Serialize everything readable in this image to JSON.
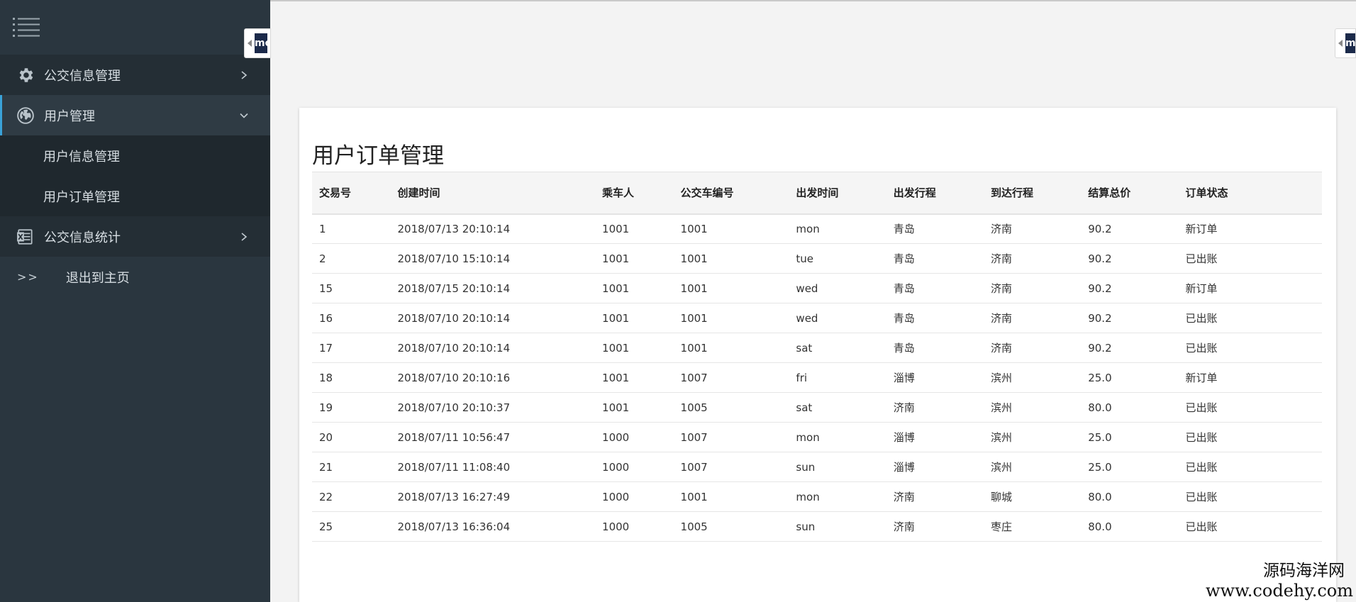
{
  "sidebar": {
    "menu": [
      {
        "label": "公交信息管理",
        "icon": "gear-icon",
        "expanded": false
      },
      {
        "label": "用户管理",
        "icon": "globe-icon",
        "expanded": true,
        "children": [
          {
            "label": "用户信息管理"
          },
          {
            "label": "用户订单管理"
          }
        ]
      },
      {
        "label": "公交信息统计",
        "icon": "excel-icon",
        "expanded": false
      }
    ],
    "exit": {
      "arrows": ">>",
      "label": "退出到主页"
    }
  },
  "card": {
    "title": "用户订单管理",
    "columns": [
      "交易号",
      "创建时间",
      "乘车人",
      "公交车编号",
      "出发时间",
      "出发行程",
      "到达行程",
      "结算总价",
      "订单状态"
    ],
    "rows": [
      [
        "1",
        "2018/07/13 20:10:14",
        "1001",
        "1001",
        "mon",
        "青岛",
        "济南",
        "90.2",
        "新订单"
      ],
      [
        "2",
        "2018/07/10 15:10:14",
        "1001",
        "1001",
        "tue",
        "青岛",
        "济南",
        "90.2",
        "已出账"
      ],
      [
        "15",
        "2018/07/15 20:10:14",
        "1001",
        "1001",
        "wed",
        "青岛",
        "济南",
        "90.2",
        "新订单"
      ],
      [
        "16",
        "2018/07/10 20:10:14",
        "1001",
        "1001",
        "wed",
        "青岛",
        "济南",
        "90.2",
        "已出账"
      ],
      [
        "17",
        "2018/07/10 20:10:14",
        "1001",
        "1001",
        "sat",
        "青岛",
        "济南",
        "90.2",
        "已出账"
      ],
      [
        "18",
        "2018/07/10 20:10:16",
        "1001",
        "1007",
        "fri",
        "淄博",
        "滨州",
        "25.0",
        "新订单"
      ],
      [
        "19",
        "2018/07/10 20:10:37",
        "1001",
        "1005",
        "sat",
        "济南",
        "滨州",
        "80.0",
        "已出账"
      ],
      [
        "20",
        "2018/07/11 10:56:47",
        "1000",
        "1007",
        "mon",
        "淄博",
        "滨州",
        "25.0",
        "已出账"
      ],
      [
        "21",
        "2018/07/11 11:08:40",
        "1000",
        "1007",
        "sun",
        "淄博",
        "滨州",
        "25.0",
        "已出账"
      ],
      [
        "22",
        "2018/07/13 16:27:49",
        "1000",
        "1001",
        "mon",
        "济南",
        "聊城",
        "80.0",
        "已出账"
      ],
      [
        "25",
        "2018/07/13 16:36:04",
        "1000",
        "1005",
        "sun",
        "济南",
        "枣庄",
        "80.0",
        "已出账"
      ]
    ]
  },
  "tabs": {
    "letter": "mo"
  },
  "watermark": {
    "cn": "源码海洋网",
    "en": "www.codehy.com"
  },
  "colors": {
    "sidebar": "#2a363f",
    "accent": "#3aa2d8"
  }
}
